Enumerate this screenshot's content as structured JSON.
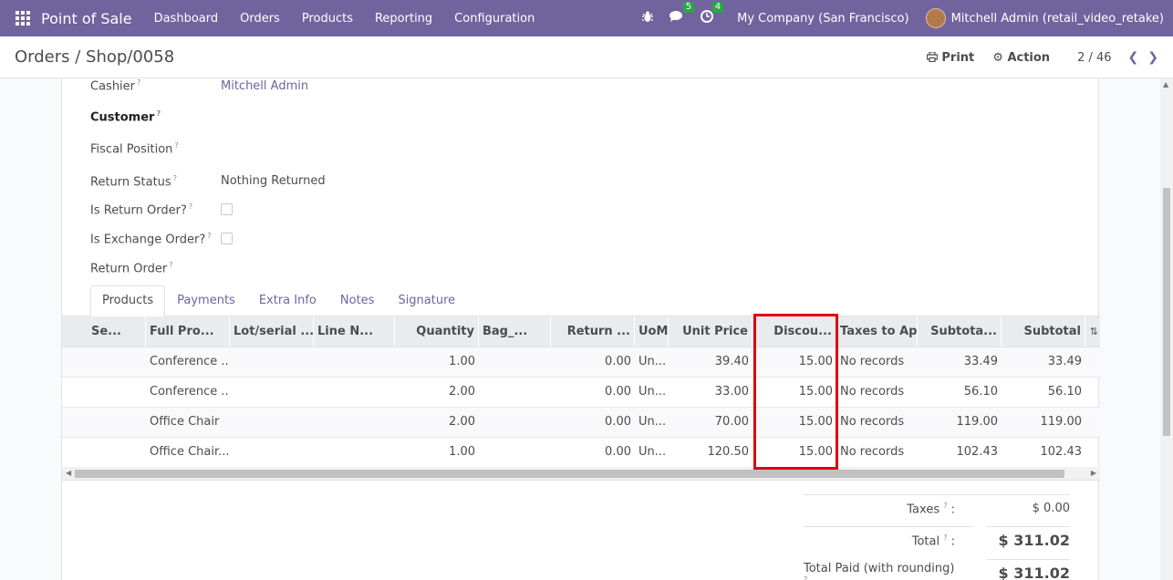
{
  "navbar": {
    "brand": "Point of Sale",
    "menu": [
      "Dashboard",
      "Orders",
      "Products",
      "Reporting",
      "Configuration"
    ],
    "messages_badge": "5",
    "activities_badge": "4",
    "company": "My Company (San Francisco)",
    "user": "Mitchell Admin (retail_video_retake)"
  },
  "control_panel": {
    "breadcrumb": "Orders / Shop/0058",
    "print_label": "Print",
    "action_label": "Action",
    "pager": "2 / 46"
  },
  "form": {
    "cashier_label": "Cashier",
    "cashier_value": "Mitchell Admin",
    "customer_label": "Customer",
    "fiscal_position_label": "Fiscal Position",
    "return_status_label": "Return Status",
    "return_status_value": "Nothing Returned",
    "is_return_order_label": "Is Return Order?",
    "is_exchange_order_label": "Is Exchange Order?",
    "return_order_label": "Return Order"
  },
  "tabs": [
    "Products",
    "Payments",
    "Extra Info",
    "Notes",
    "Signature"
  ],
  "table": {
    "columns": [
      "Se...",
      "Full Pro...",
      "Lot/serial ...",
      "Line N...",
      "Quantity",
      "Bag_...",
      "Return ...",
      "UoM",
      "Unit Price",
      "Discou...",
      "Taxes to Ap...",
      "Subtota...",
      "Subtotal"
    ],
    "rows": [
      {
        "product": "Conference ...",
        "qty": "1.00",
        "return": "0.00",
        "uom": "Un...",
        "price": "39.40",
        "discount": "15.00",
        "taxes": "No records",
        "subtotal1": "33.49",
        "subtotal2": "33.49"
      },
      {
        "product": "Conference ...",
        "qty": "2.00",
        "return": "0.00",
        "uom": "Un...",
        "price": "33.00",
        "discount": "15.00",
        "taxes": "No records",
        "subtotal1": "56.10",
        "subtotal2": "56.10"
      },
      {
        "product": "Office Chair",
        "qty": "2.00",
        "return": "0.00",
        "uom": "Un...",
        "price": "70.00",
        "discount": "15.00",
        "taxes": "No records",
        "subtotal1": "119.00",
        "subtotal2": "119.00"
      },
      {
        "product": "Office Chair...",
        "qty": "1.00",
        "return": "0.00",
        "uom": "Un...",
        "price": "120.50",
        "discount": "15.00",
        "taxes": "No records",
        "subtotal1": "102.43",
        "subtotal2": "102.43"
      }
    ]
  },
  "totals": {
    "taxes_label": "Taxes",
    "taxes_value": "$ 0.00",
    "total_label": "Total",
    "total_value": "$ 311.02",
    "paid_label": "Total Paid (with rounding)",
    "paid_value": "$ 311.02"
  },
  "colors": {
    "brand": "#71639e",
    "highlight": "#e00000",
    "badge": "#28a745"
  }
}
